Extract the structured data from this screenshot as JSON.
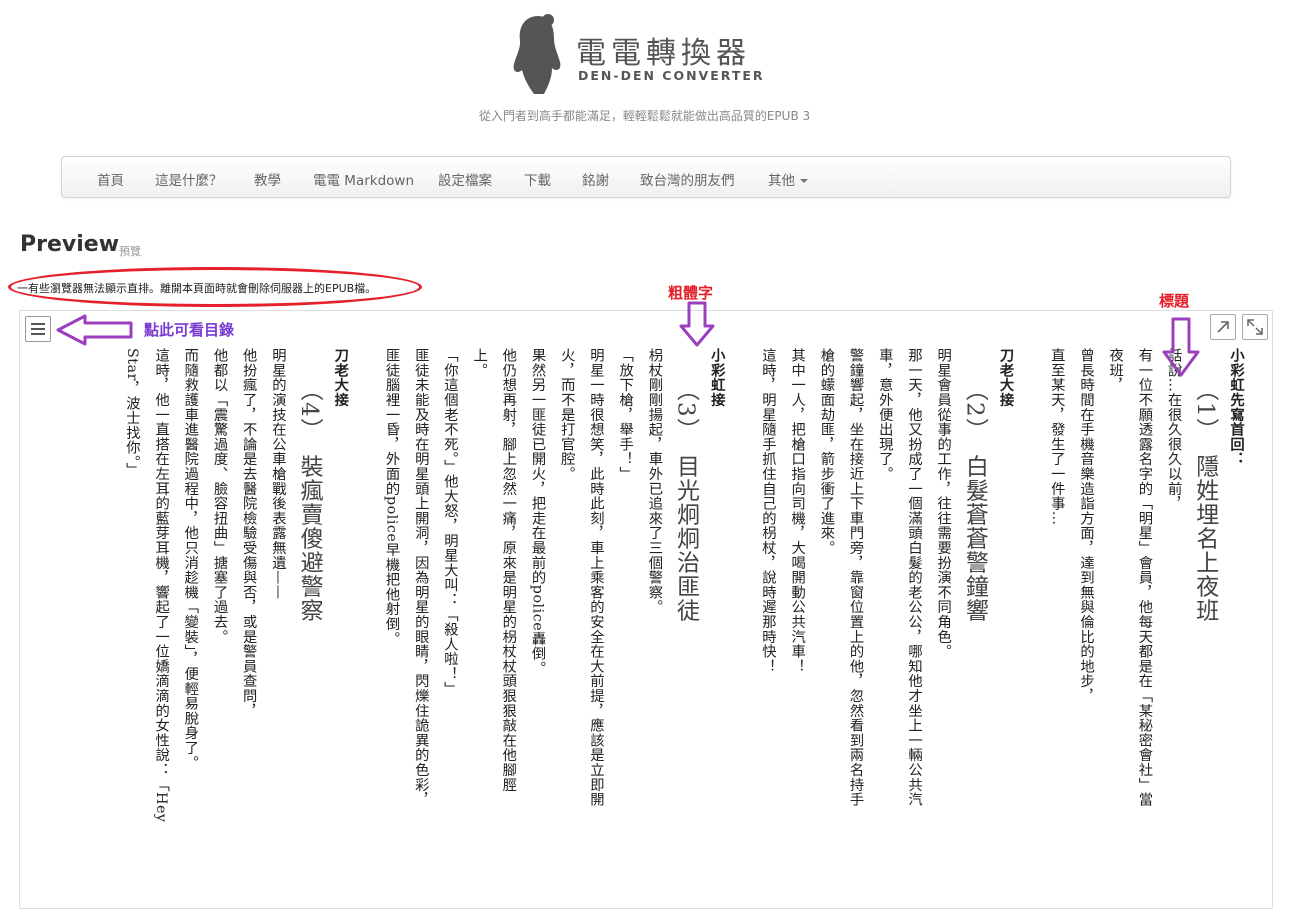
{
  "header": {
    "logo_cn": "電電轉換器",
    "logo_en": "DEN-DEN CONVERTER",
    "tagline": "從入門者到高手都能滿足，輕輕鬆鬆就能做出高品質的EPUB 3"
  },
  "nav": {
    "items": [
      "首頁",
      "這是什麼？",
      "教學",
      "電電 Markdown",
      "設定檔案",
      "下載",
      "銘謝",
      "致台灣的朋友們",
      "其他"
    ]
  },
  "page": {
    "title": "Preview",
    "subtitle": "預覽",
    "notice": "一有些瀏覽器無法顯示直排。離開本頁面時就會刪除伺服器上的EPUB檔。"
  },
  "annotations": {
    "toc": "點此可看目錄",
    "bold": "粗體字",
    "heading": "標題"
  },
  "colors": {
    "annotation_red": "#e5202a",
    "annotation_purple": "#7a3bd1"
  },
  "icons": [
    "menu-icon",
    "open-external-icon",
    "fullscreen-icon"
  ],
  "book": {
    "lines": [
      {
        "t": "b",
        "text": "小彩虹先寫首回："
      },
      {
        "t": "h",
        "text": "（1）　隱姓埋名上夜班"
      },
      {
        "t": "p",
        "text": "話說…在很久很久以前，"
      },
      {
        "t": "p",
        "text": "有一位不願透露名字的「明星」會員，他每天都是在「某秘密會社」當"
      },
      {
        "t": "p",
        "text": "夜班，"
      },
      {
        "t": "p",
        "text": "曾長時間在手機音樂造詣方面，達到無與倫比的地步，"
      },
      {
        "t": "p",
        "text": "直至某天，發生了一件事…"
      },
      {
        "t": "blank",
        "text": ""
      },
      {
        "t": "b",
        "text": "刀老大接"
      },
      {
        "t": "h",
        "text": "（2）　白髮蒼蒼警鐘響"
      },
      {
        "t": "p",
        "text": "明星會員從事的工作，往往需要扮演不同角色。"
      },
      {
        "t": "p",
        "text": "那一天，他又扮成了一個滿頭白髮的老公公，哪知他才坐上一輛公共汽"
      },
      {
        "t": "p",
        "text": "車，意外便出現了。"
      },
      {
        "t": "p",
        "text": "警鐘響起，坐在接近上下車門旁，靠窗位置上的他，忽然看到兩名持手"
      },
      {
        "t": "p",
        "text": "槍的蠓面劫匪，箭步衝了進來。"
      },
      {
        "t": "p",
        "text": "其中一人，把槍口指向司機，大喝開動公共汽車！"
      },
      {
        "t": "p",
        "text": "這時，明星隨手抓住自己的枴杖，說時遲那時快！"
      },
      {
        "t": "blank",
        "text": ""
      },
      {
        "t": "b",
        "text": "小彩虹接"
      },
      {
        "t": "h",
        "text": "（3）　目光炯炯治匪徒"
      },
      {
        "t": "p",
        "text": "枴杖剛剛揚起，車外已追來了三個警察。"
      },
      {
        "t": "p",
        "text": "「放下槍，舉手！」"
      },
      {
        "t": "p",
        "text": "明星一時很想笑，此時此刻，車上乘客的安全在大前提，應該是立即開"
      },
      {
        "t": "p",
        "text": "火，而不是打官腔。"
      },
      {
        "t": "p",
        "text": "果然另一匪徒已開火，把走在最前的police轟倒。"
      },
      {
        "t": "p",
        "text": "他仍想再射，腳上忽然一痛，原來是明星的枴杖杖頭狠狠敲在他腳脛"
      },
      {
        "t": "p",
        "text": "上。"
      },
      {
        "t": "p",
        "text": "「你這個老不死。」他大怒，明星大叫：「殺人啦！」"
      },
      {
        "t": "p",
        "text": "匪徒未能及時在明星頭上開洞，因為明星的眼睛，閃爍住詭異的色彩，"
      },
      {
        "t": "p",
        "text": "匪徒腦裡一昏，外面的police早機把他射倒。"
      },
      {
        "t": "blank",
        "text": ""
      },
      {
        "t": "b",
        "text": "刀老大接"
      },
      {
        "t": "h",
        "text": "（4）　裝瘋賣傻避警察"
      },
      {
        "t": "p",
        "text": "明星的演技在公車槍戰後表露無遺——"
      },
      {
        "t": "p",
        "text": "他扮瘋了，不論是去醫院檢驗受傷與否，或是警員查問，"
      },
      {
        "t": "p",
        "text": "他都以「震驚過度、臉容扭曲」搪塞了過去。"
      },
      {
        "t": "p",
        "text": "而隨救護車進醫院過程中，他只消趁機「變裝」，便輕易脫身了。"
      },
      {
        "t": "p",
        "text": "這時，他一直搭在左耳的藍芽耳機，響起了一位嬌滴滴的女性說：「Hey"
      },
      {
        "t": "p",
        "text": "Star，波士找你。」"
      }
    ]
  }
}
